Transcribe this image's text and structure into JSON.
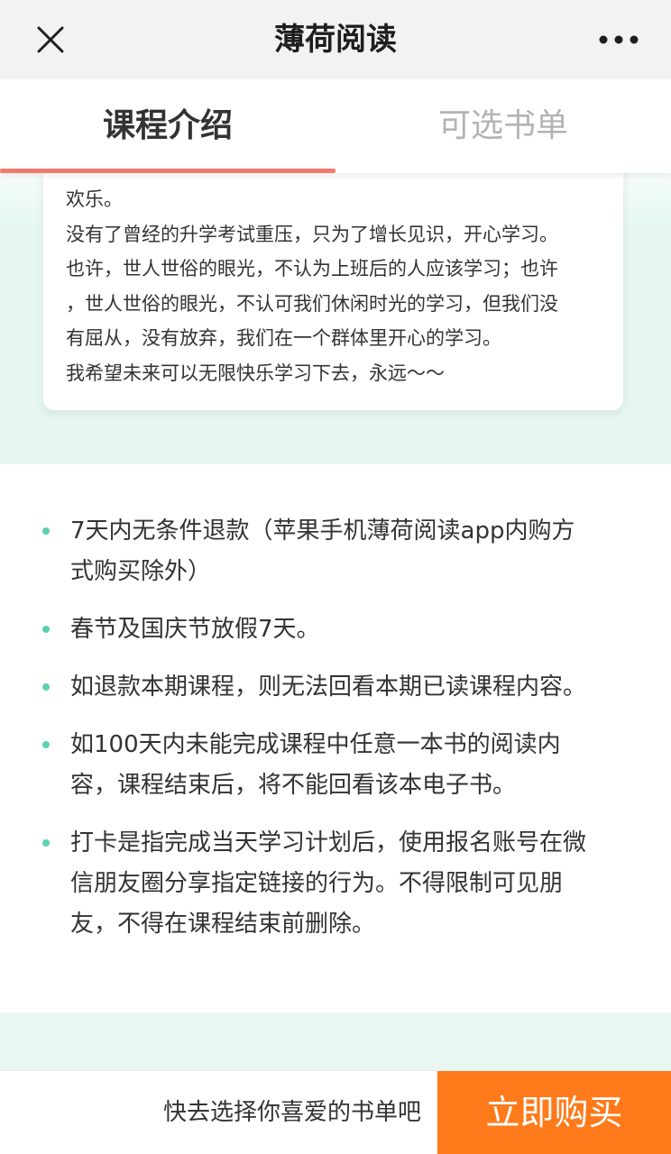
{
  "navbar": {
    "title": "薄荷阅读"
  },
  "tabs": [
    {
      "label": "课程介绍",
      "active": true
    },
    {
      "label": "可选书单",
      "active": false
    }
  ],
  "card": {
    "lines": [
      "欢乐。",
      "没有了曾经的升学考试重压，只为了增长见识，开心学习。",
      "也许，世人世俗的眼光，不认为上班后的人应该学习；也许",
      "，世人世俗的眼光，不认可我们休闲时光的学习，但我们没",
      "有屈从，没有放弃，我们在一个群体里开心的学习。",
      "我希望未来可以无限快乐学习下去，永远～～"
    ]
  },
  "rules": [
    {
      "lines": [
        "7天内无条件退款（苹果手机薄荷阅读app内购方",
        "式购买除外）"
      ]
    },
    {
      "lines": [
        "春节及国庆节放假7天。"
      ]
    },
    {
      "lines": [
        "如退款本期课程，则无法回看本期已读课程内容。"
      ]
    },
    {
      "lines": [
        "如100天内未能完成课程中任意一本书的阅读内",
        "容，课程结束后，将不能回看该本电子书。"
      ]
    },
    {
      "lines": [
        "打卡是指完成当天学习计划后，使用报名账号在微",
        "信朋友圈分享指定链接的行为。不得限制可见朋",
        "友，不得在课程结束前删除。"
      ]
    }
  ],
  "bottombar": {
    "hint": "快去选择你喜爱的书单吧",
    "buy_label": "立即购买"
  },
  "colors": {
    "accent_underline": "#f27a6a",
    "bullet": "#5ecfb1",
    "teal_bg": "#e6f7f2",
    "buy_button": "#ff7a1a"
  },
  "icons": {
    "close": "close-icon",
    "more": "more-icon"
  }
}
